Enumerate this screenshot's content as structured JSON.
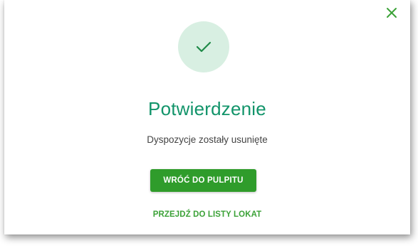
{
  "dialog": {
    "title": "Potwierdzenie",
    "message": "Dyspozycje zostały usunięte",
    "primary_button_label": "WRÓĆ DO PULPITU",
    "secondary_link_label": "PRZEJDŹ DO LISTY LOKAT"
  },
  "icons": {
    "close": "close-icon",
    "success": "checkmark-icon"
  },
  "colors": {
    "accent": "#2f9c2b",
    "title": "#12946a",
    "success_circle_bg": "#d8efe2",
    "link": "#3ca238"
  }
}
